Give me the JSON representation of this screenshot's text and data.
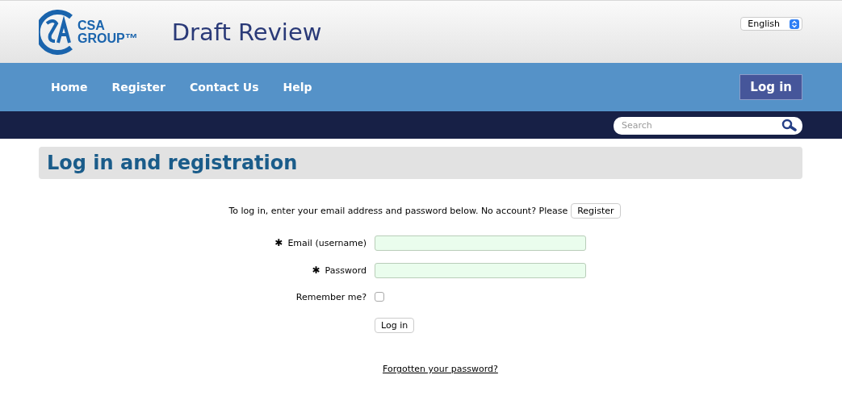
{
  "header": {
    "logo": {
      "line_1": "CSA",
      "line_2": "GROUP™"
    },
    "site_title": "Draft Review",
    "language": "English"
  },
  "nav": {
    "items": [
      {
        "label": "Home"
      },
      {
        "label": "Register"
      },
      {
        "label": "Contact Us"
      },
      {
        "label": "Help"
      }
    ],
    "login_button": "Log in"
  },
  "search": {
    "placeholder": "Search"
  },
  "page_title": "Log in and registration",
  "intro": {
    "text": "To log in, enter your email address and password below. No account? Please",
    "register_button": "Register"
  },
  "fields": [
    {
      "kind": "text",
      "required_mark": "✱",
      "label": "Email (username)"
    },
    {
      "kind": "password",
      "required_mark": "✱",
      "label": "Password"
    },
    {
      "kind": "checkbox",
      "label": "Remember me?",
      "checked": false
    }
  ],
  "submit": "Log in",
  "forgot_link": "Forgotten your password?"
}
